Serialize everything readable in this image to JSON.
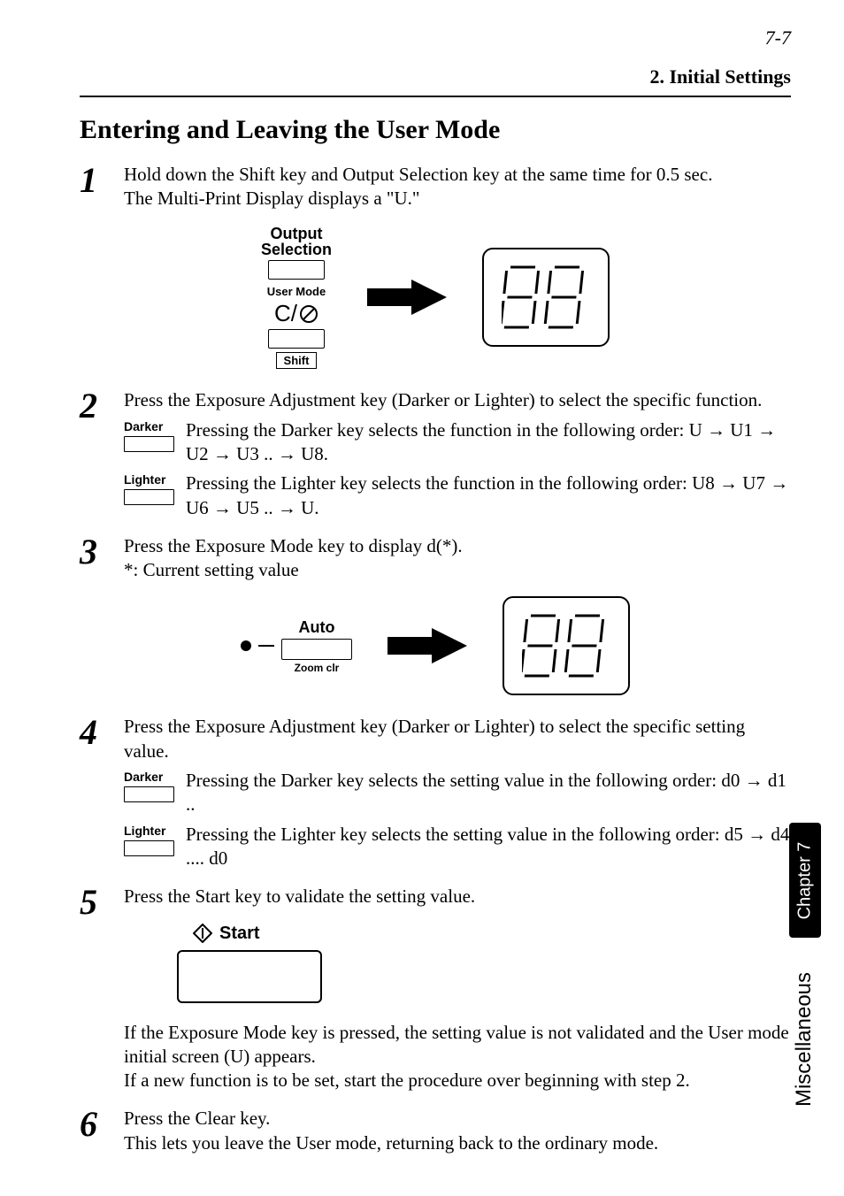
{
  "header": {
    "page_number": "7-7",
    "breadcrumb": "2. Initial Settings"
  },
  "title": "Entering and Leaving the User Mode",
  "steps": {
    "s1": {
      "num": "1",
      "line1": "Hold down the Shift key and Output Selection key at the same time for 0.5 sec.",
      "line2": "The Multi-Print Display displays a \"U.\""
    },
    "s2": {
      "num": "2",
      "intro": "Press the Exposure Adjustment key (Darker or Lighter) to select the specific function.",
      "darker_label": "Darker",
      "darker_text": "Pressing the Darker key selects the function in the following order: U → U1 → U2 → U3 .. → U8.",
      "lighter_label": "Lighter",
      "lighter_text": "Pressing the Lighter key selects the function in the following order: U8 → U7 → U6 → U5 .. → U."
    },
    "s3": {
      "num": "3",
      "line1": "Press the Exposure Mode key to display d(*).",
      "line2": "*: Current setting value"
    },
    "s4": {
      "num": "4",
      "intro": "Press the Exposure Adjustment key (Darker or Lighter) to select the specific setting value.",
      "darker_label": "Darker",
      "darker_text": "Pressing the Darker key selects the setting value in the following order: d0 → d1 ..",
      "lighter_label": "Lighter",
      "lighter_text": "Pressing the Lighter key selects the setting value in the following order: d5 → d4 .... d0"
    },
    "s5": {
      "num": "5",
      "line1": "Press the Start key to validate the setting value.",
      "after1": "If the Exposure Mode key is pressed, the setting value is not validated and the User mode initial screen (U) appears.",
      "after2": "If a new function is to be set, start the procedure over beginning with step 2."
    },
    "s6": {
      "num": "6",
      "line1": "Press the Clear key.",
      "line2": "This lets you leave the User mode, returning back to the ordinary mode."
    }
  },
  "diagram1": {
    "output": "Output",
    "selection": "Selection",
    "user_mode": "User  Mode",
    "c_prefix": "C/",
    "shift": "Shift"
  },
  "diagram2": {
    "auto": "Auto",
    "zoom_clr": "Zoom clr"
  },
  "start": {
    "label": "Start"
  },
  "side": {
    "chapter": "Chapter 7",
    "section": "Miscellaneous"
  }
}
